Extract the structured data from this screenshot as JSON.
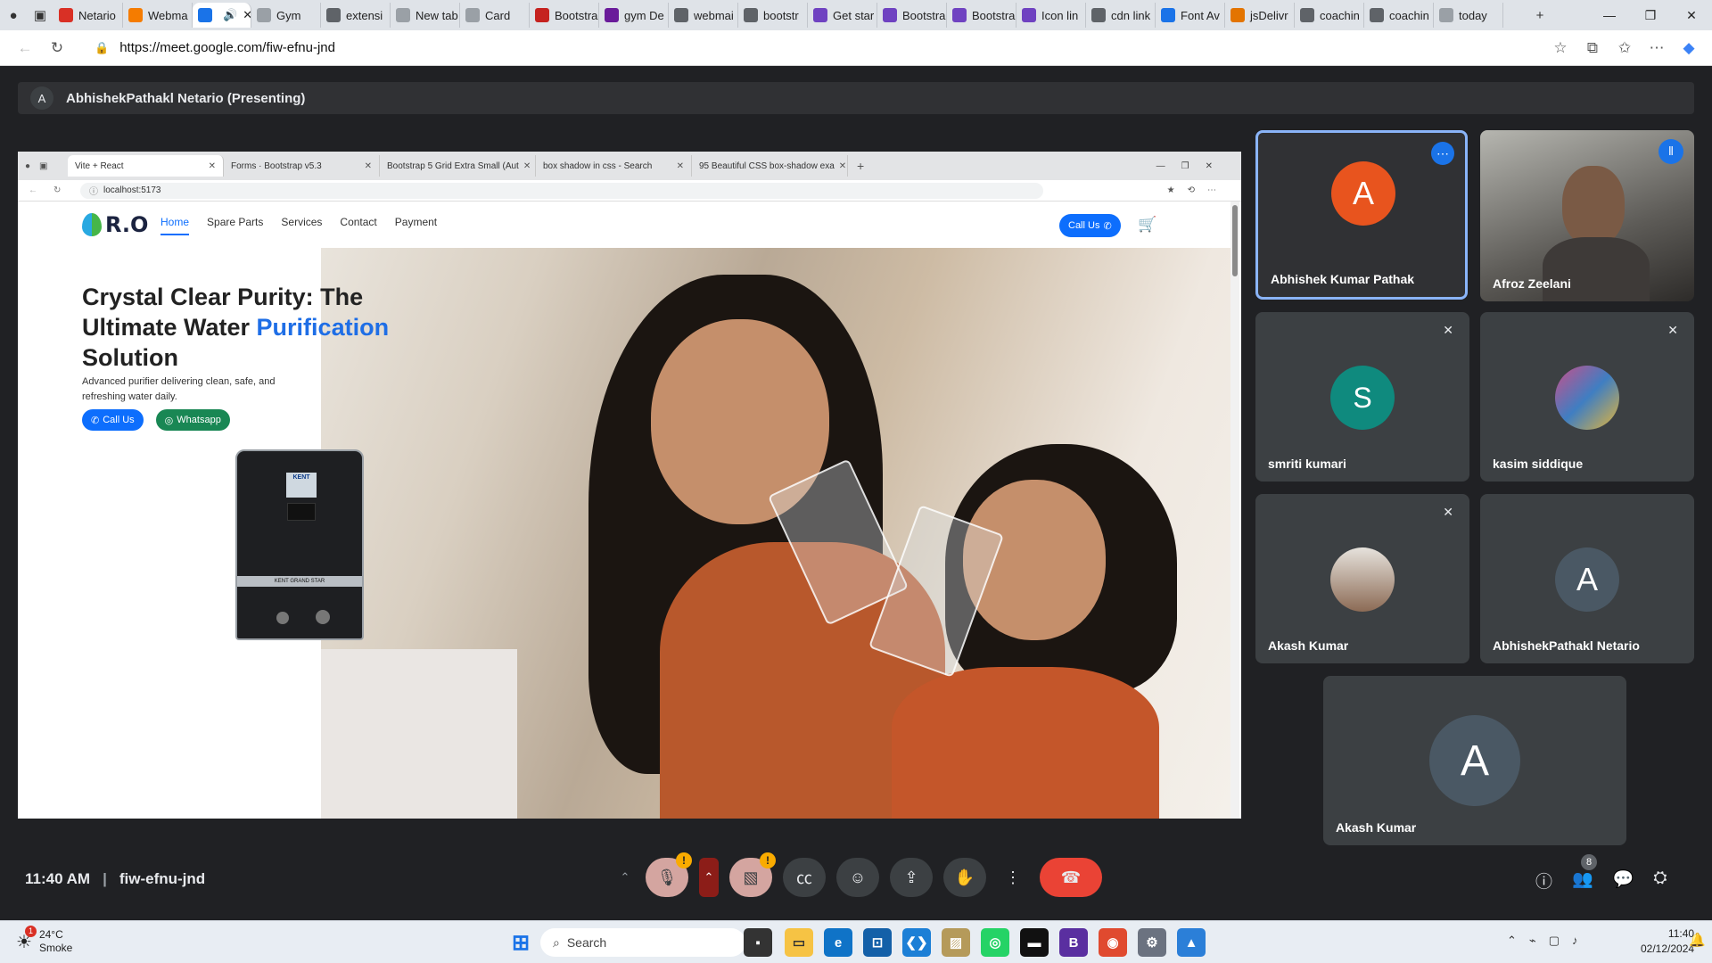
{
  "browser": {
    "tabs": [
      "Netario",
      "Webma",
      "",
      "Gym",
      "extensi",
      "New tab",
      "Card",
      "Bootstra",
      "gym De",
      "webmai",
      "bootstr",
      "Get star",
      "Bootstra",
      "Bootstra",
      "Icon lin",
      "cdn link",
      "Font Av",
      "jsDelivr",
      "coachin",
      "coachin",
      "today"
    ],
    "url": "https://meet.google.com/fiw-efnu-jnd"
  },
  "meet": {
    "presenter_initial": "A",
    "presenter_label": "AbhishekPathakl Netario (Presenting)",
    "time": "11:40 AM",
    "meeting_code": "fiw-efnu-jnd",
    "people_count": "8"
  },
  "shared": {
    "tabs": [
      "Vite + React",
      "Forms · Bootstrap v5.3",
      "Bootstrap 5 Grid Extra Small (Aut",
      "box shadow in css - Search",
      "95 Beautiful CSS box-shadow exa"
    ],
    "url": "localhost:5173",
    "site": {
      "logo": "R.O",
      "nav": [
        "Home",
        "Spare Parts",
        "Services",
        "Contact",
        "Payment"
      ],
      "call_us": "Call Us",
      "hero_line1": "Crystal Clear Purity: The",
      "hero_line2a": "Ultimate Water ",
      "hero_line2b": "Purification",
      "hero_line3": "Solution",
      "hero_desc": "Advanced purifier delivering clean, safe, and refreshing water daily.",
      "btn_call": "Call Us",
      "btn_whatsapp": "Whatsapp",
      "product_brand": "KENT",
      "product_model": "KENT GRAND STAR"
    }
  },
  "participants": [
    {
      "name": "Abhishek Kumar Pathak",
      "initial": "A",
      "color": "#e8541e"
    },
    {
      "name": "Afroz Zeelani"
    },
    {
      "name": "smriti kumari",
      "initial": "S",
      "color": "#0f8a7e"
    },
    {
      "name": "kasim siddique"
    },
    {
      "name": "Akash Kumar"
    },
    {
      "name": "AbhishekPathakl Netario",
      "initial": "A",
      "color": "#4a5864"
    },
    {
      "name": "Akash Kumar",
      "initial": "A",
      "color": "#4a5864"
    }
  ],
  "taskbar": {
    "temp": "24°C",
    "weather": "Smoke",
    "badge": "1",
    "search": "Search",
    "time": "11:40",
    "date": "02/12/2024"
  }
}
